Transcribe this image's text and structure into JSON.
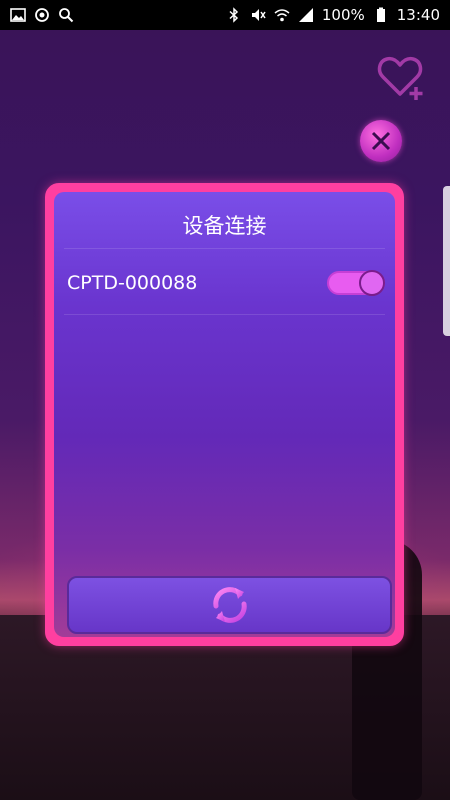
{
  "status_bar": {
    "battery_percent": "100%",
    "time": "13:40",
    "left_icons": [
      "image-icon",
      "sync-icon",
      "search-icon"
    ],
    "right_icons": [
      "bluetooth-icon",
      "mute-icon",
      "wifi-icon",
      "signal-icon",
      "battery-icon"
    ]
  },
  "header": {
    "favorite_icon": "heart-plus-icon",
    "close_icon": "close-icon"
  },
  "dialog": {
    "title": "设备连接",
    "devices": [
      {
        "name": "CPTD-000088",
        "connected": true
      }
    ],
    "refresh_icon": "refresh-icon"
  },
  "colors": {
    "accent_pink": "#ff3fa0",
    "dialog_purple": "#6a35cf",
    "toggle_on": "#e85cf0"
  }
}
